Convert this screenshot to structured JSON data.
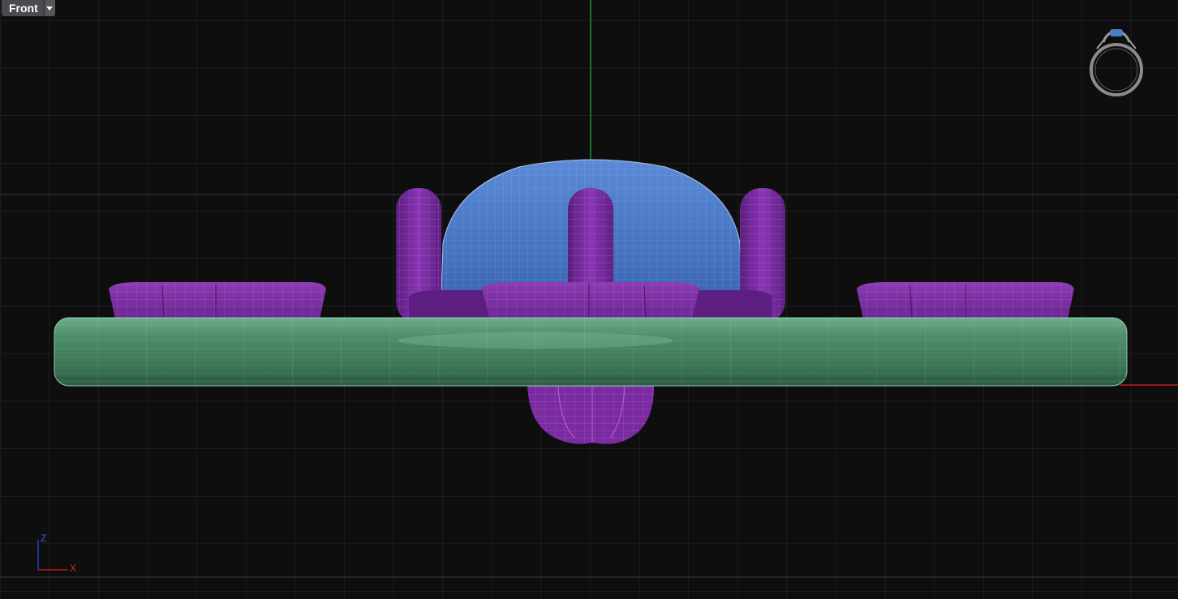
{
  "viewport": {
    "name": "Front",
    "dropdown_icon": "chevron-down-icon"
  },
  "colors": {
    "background": "#0e0e0f",
    "grid": "#2b2b2d",
    "axis_z": "#1f8a2a",
    "axis_x": "#c0181d",
    "band": "#4a8a66",
    "stone": "#4f7ec8",
    "prongs": "#7a2ba0"
  },
  "axes_indicator": {
    "z_label": "Z",
    "x_label": "X"
  },
  "navigation_widget": {
    "icon": "ring-preview-icon"
  }
}
